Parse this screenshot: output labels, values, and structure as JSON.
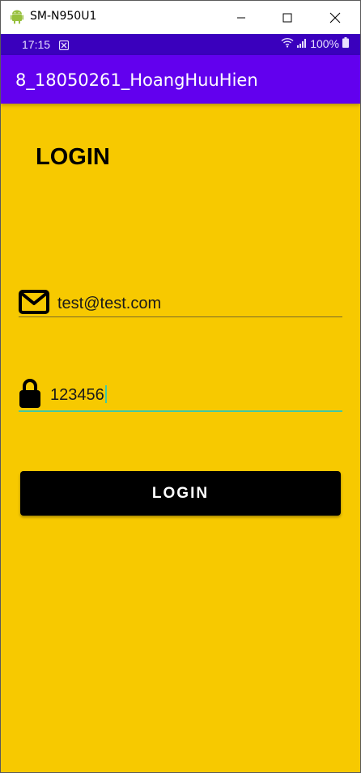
{
  "window": {
    "title": "SM-N950U1",
    "icon": "android-icon",
    "controls": [
      "minimize-icon",
      "maximize-icon",
      "close-icon"
    ]
  },
  "status_bar": {
    "time": "17:15",
    "battery": "100%",
    "icons": [
      "notification-icon",
      "wifi-icon",
      "signal-icon",
      "battery-icon"
    ]
  },
  "app_bar": {
    "title": "8_18050261_HoangHuuHien"
  },
  "login": {
    "heading": "LOGIN",
    "email": {
      "value": "test@test.com",
      "icon": "mail-icon"
    },
    "password": {
      "value": "123456",
      "icon": "lock-icon"
    },
    "button_label": "LOGIN"
  },
  "colors": {
    "background": "#f7c900",
    "status_bar": "#3a00bd",
    "app_bar": "#6200ee",
    "focus_underline": "#41c9a3",
    "button": "#000000"
  }
}
